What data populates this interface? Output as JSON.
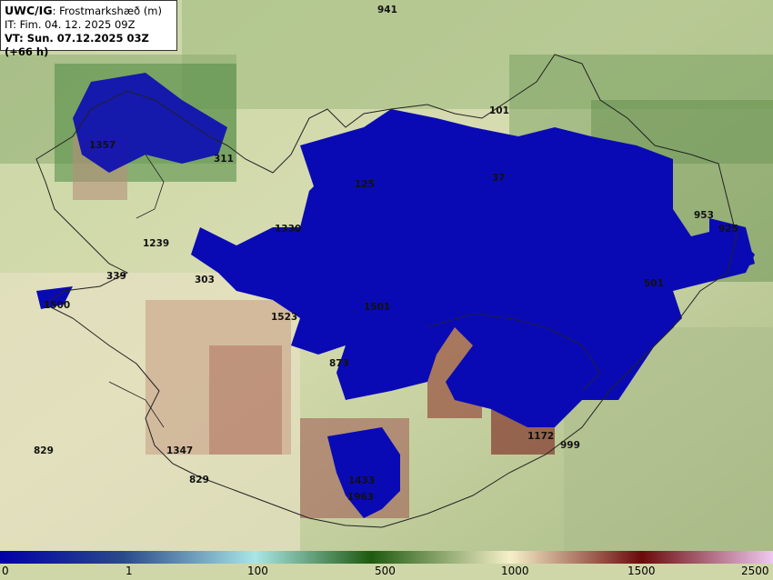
{
  "header": {
    "model": "UWC/IG",
    "title_rest": ": Frostmarkshæð (m)",
    "it_line": "IT: Fim. 04. 12. 2025 09Z",
    "vt_line": "VT: Sun. 07.12.2025 03Z (+66 h)"
  },
  "map_labels": [
    {
      "text": "941",
      "name": "label-941"
    },
    {
      "text": "101",
      "name": "label-101"
    },
    {
      "text": "1357",
      "name": "label-1357"
    },
    {
      "text": "311",
      "name": "label-311"
    },
    {
      "text": "125",
      "name": "label-125"
    },
    {
      "text": "37",
      "name": "label-37"
    },
    {
      "text": "953",
      "name": "label-953"
    },
    {
      "text": "925",
      "name": "label-925"
    },
    {
      "text": "1239",
      "name": "label-1239"
    },
    {
      "text": "1330",
      "name": "label-1330"
    },
    {
      "text": "339",
      "name": "label-339"
    },
    {
      "text": "303",
      "name": "label-303"
    },
    {
      "text": "501",
      "name": "label-501"
    },
    {
      "text": "1500",
      "name": "label-1500-left"
    },
    {
      "text": "1523",
      "name": "label-1523"
    },
    {
      "text": "1501",
      "name": "label-1501"
    },
    {
      "text": "873",
      "name": "label-873"
    },
    {
      "text": "1172",
      "name": "label-1172"
    },
    {
      "text": "999",
      "name": "label-999"
    },
    {
      "text": "829",
      "name": "label-829-west"
    },
    {
      "text": "1347",
      "name": "label-1347"
    },
    {
      "text": "829",
      "name": "label-829-south"
    },
    {
      "text": "1433",
      "name": "label-1433"
    },
    {
      "text": "1963",
      "name": "label-1963"
    }
  ],
  "colorbar": {
    "ticks": [
      "0",
      "1",
      "100",
      "500",
      "1000",
      "1500",
      "2500"
    ],
    "colors": [
      "#0000a8",
      "#2a4a8a",
      "#a9e6e6",
      "#1f5a10",
      "#f5f0c8",
      "#6b0a0a",
      "#f0c8f0"
    ]
  }
}
